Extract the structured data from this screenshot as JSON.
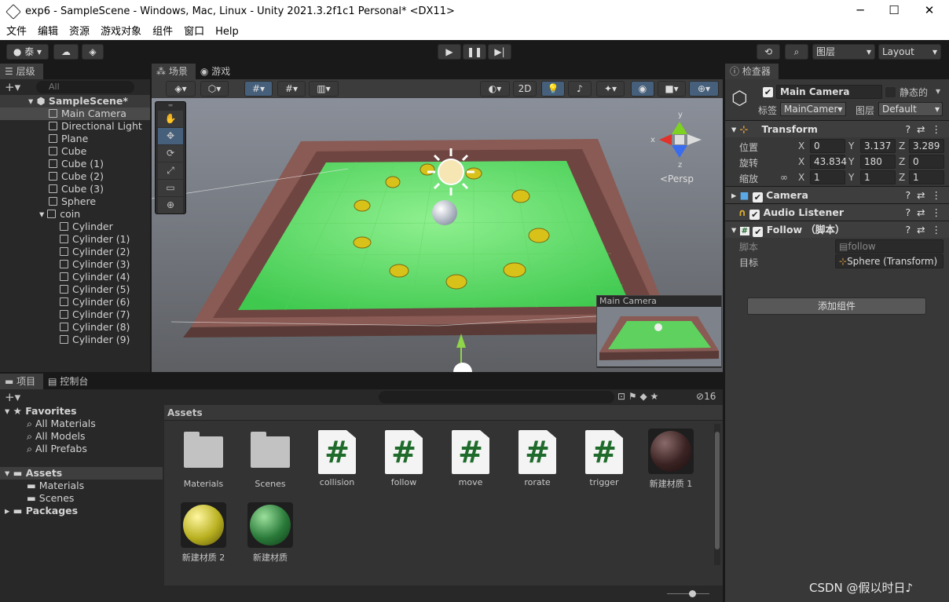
{
  "window": {
    "title": "exp6 - SampleScene - Windows, Mac, Linux - Unity 2021.3.2f1c1 Personal* <DX11>",
    "min": "─",
    "max": "☐",
    "close": "✕"
  },
  "menu": [
    "文件",
    "编辑",
    "资源",
    "游戏对象",
    "组件",
    "窗口",
    "Help"
  ],
  "toolbar": {
    "account": "泰",
    "layers": "图层",
    "layout": "Layout"
  },
  "hierarchy": {
    "tab": "层级",
    "search_placeholder": "All",
    "scene": "SampleScene*",
    "items": [
      "Main Camera",
      "Directional Light",
      "Plane",
      "Cube",
      "Cube (1)",
      "Cube (2)",
      "Cube (3)",
      "Sphere",
      "coin"
    ],
    "children": [
      "Cylinder",
      "Cylinder (1)",
      "Cylinder (2)",
      "Cylinder (3)",
      "Cylinder (4)",
      "Cylinder (5)",
      "Cylinder (6)",
      "Cylinder (7)",
      "Cylinder (8)",
      "Cylinder (9)"
    ]
  },
  "scene": {
    "tab_scene": "场景",
    "tab_game": "游戏",
    "mode2d": "2D",
    "persp": "<Persp",
    "axis_x": "x",
    "axis_y": "y",
    "axis_z": "z",
    "preview_title": "Main Camera"
  },
  "inspector": {
    "tab": "检查器",
    "name": "Main Camera",
    "static": "静态的",
    "tag_label": "标签",
    "tag": "MainCamer▾",
    "layer_label": "图层",
    "layer": "Default",
    "transform": {
      "title": "Transform",
      "pos_label": "位置",
      "rot_label": "旋转",
      "scale_label": "缩放",
      "position": {
        "x": "0",
        "y": "3.137",
        "z": "3.289"
      },
      "rotation": {
        "x": "43.834",
        "y": "180",
        "z": "0"
      },
      "scale": {
        "x": "1",
        "y": "1",
        "z": "1"
      }
    },
    "camera": "Camera",
    "audio": "Audio Listener",
    "follow": "Follow （脚本）",
    "script_label": "脚本",
    "script_value": "follow",
    "target_label": "目标",
    "target_value": "Sphere (Transform)",
    "add_component": "添加组件"
  },
  "project": {
    "tab_project": "项目",
    "tab_console": "控制台",
    "count": "16",
    "favorites": "Favorites",
    "fav_items": [
      "All Materials",
      "All Models",
      "All Prefabs"
    ],
    "assets": "Assets",
    "asset_folders": [
      "Materials",
      "Scenes"
    ],
    "packages": "Packages",
    "breadcrumb": "Assets",
    "files": [
      {
        "name": "Materials",
        "kind": "folder"
      },
      {
        "name": "Scenes",
        "kind": "folder"
      },
      {
        "name": "collision",
        "kind": "script"
      },
      {
        "name": "follow",
        "kind": "script"
      },
      {
        "name": "move",
        "kind": "script"
      },
      {
        "name": "rorate",
        "kind": "script"
      },
      {
        "name": "trigger",
        "kind": "script"
      },
      {
        "name": "新建材质 1",
        "kind": "material",
        "color": "#3a2222"
      },
      {
        "name": "新建材质 2",
        "kind": "material",
        "color": "#b8b020"
      },
      {
        "name": "新建材质",
        "kind": "material",
        "color": "#2a7a3a"
      }
    ]
  },
  "watermark": "CSDN @假以时日♪"
}
